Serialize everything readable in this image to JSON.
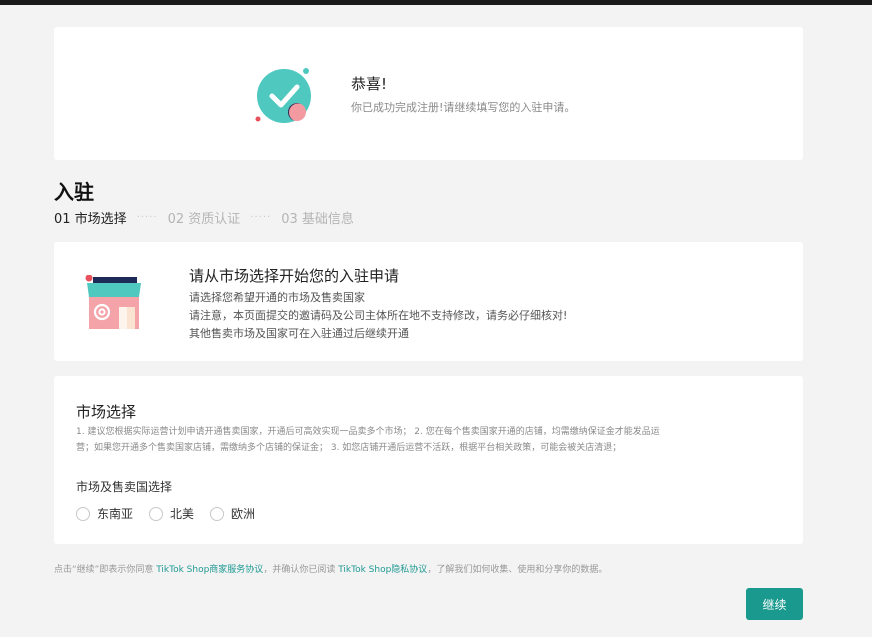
{
  "success": {
    "title": "恭喜!",
    "subtitle": "你已成功完成注册!请继续填写您的入驻申请。"
  },
  "page": {
    "heading": "入驻",
    "steps": [
      {
        "label": "01 市场选择",
        "active": true
      },
      {
        "label": "02 资质认证",
        "active": false
      },
      {
        "label": "03 基础信息",
        "active": false
      }
    ],
    "step_separator": "·····"
  },
  "info": {
    "title": "请从市场选择开始您的入驻申请",
    "lines": [
      "请选择您希望开通的市场及售卖国家",
      "请注意，本页面提交的邀请码及公司主体所在地不支持修改，请务必仔细核对!",
      "其他售卖市场及国家可在入驻通过后继续开通"
    ]
  },
  "market": {
    "title": "市场选择",
    "desc_line1": "1. 建议您根据实际运营计划申请开通售卖国家，开通后可高效实现一品卖多个市场； 2. 您在每个售卖国家开通的店铺，均需缴纳保证金才能发品运",
    "desc_line2": "营；如果您开通多个售卖国家店铺，需缴纳多个店铺的保证金； 3. 如您店铺开通后运营不活跃，根据平台相关政策，可能会被关店清退；",
    "select_label": "市场及售卖国选择",
    "options": [
      "东南亚",
      "北美",
      "欧洲"
    ],
    "selected": ""
  },
  "agreement": {
    "prefix": "点击“继续”即表示你同意 ",
    "link1": "TikTok Shop商家服务协议",
    "middle": "，并确认你已阅读 ",
    "link2": "TikTok Shop隐私协议",
    "suffix": "，了解我们如何收集、使用和分享你的数据。"
  },
  "continue_button": "继续",
  "colors": {
    "brand": "#1a9a8e",
    "check_circle": "#4fc9c0",
    "awning": "#4fc9c0",
    "shop_body": "#f4a3a8",
    "accent_red": "#e8505b",
    "accent_navy": "#1d2a57"
  },
  "icons": {
    "success": "check-circle-icon",
    "shop": "storefront-icon"
  }
}
